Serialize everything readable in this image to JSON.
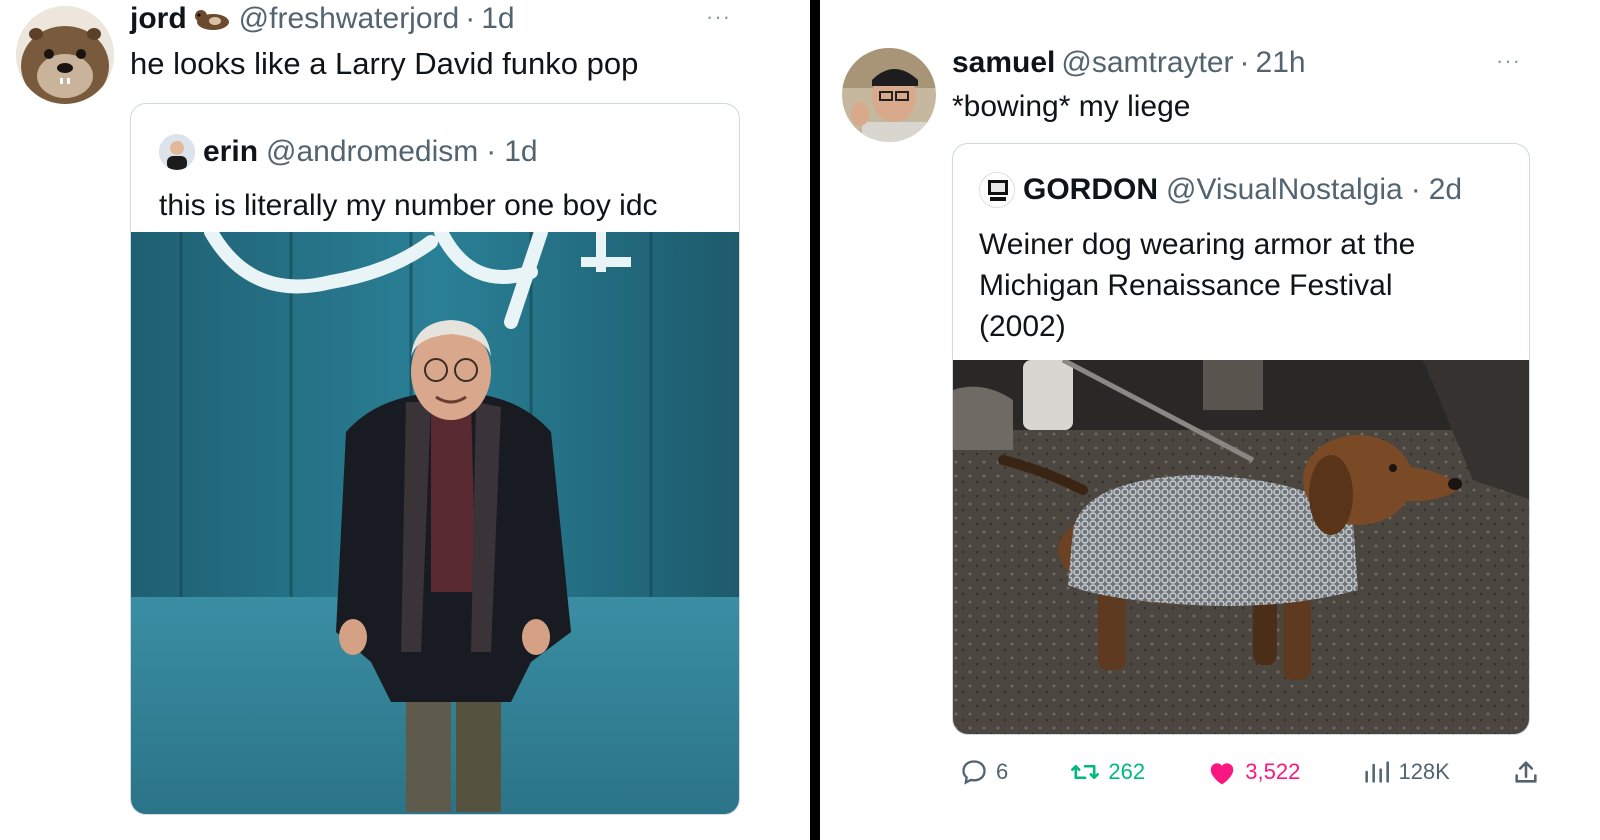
{
  "left_tweet": {
    "name": "jord",
    "handle": "@freshwaterjord",
    "separator": "·",
    "time": "1d",
    "text": "he looks like a Larry David funko pop",
    "more_icon": "more-dots-icon",
    "quote": {
      "name": "erin",
      "handle": "@andromedism",
      "separator": "·",
      "time": "1d",
      "text": "this is literally my number one boy idc",
      "sign_text": "Disney+"
    }
  },
  "right_tweet": {
    "name": "samuel",
    "handle": "@samtrayter",
    "separator": "·",
    "time": "21h",
    "text": "*bowing* my liege",
    "more_icon": "more-dots-icon",
    "quote": {
      "name": "GORDON",
      "handle": "@VisualNostalgia",
      "separator": "·",
      "time": "2d",
      "text": "Weiner dog wearing armor at the Michigan Renaissance Festival (2002)"
    },
    "actions": {
      "replies": "6",
      "reposts": "262",
      "likes": "3,522",
      "views": "128K"
    }
  },
  "colors": {
    "text": "#0f1419",
    "secondary": "#536471",
    "border": "#cfd9de",
    "repost_green": "#00ba7c",
    "like_pink": "#f91880",
    "divider": "#000000"
  }
}
